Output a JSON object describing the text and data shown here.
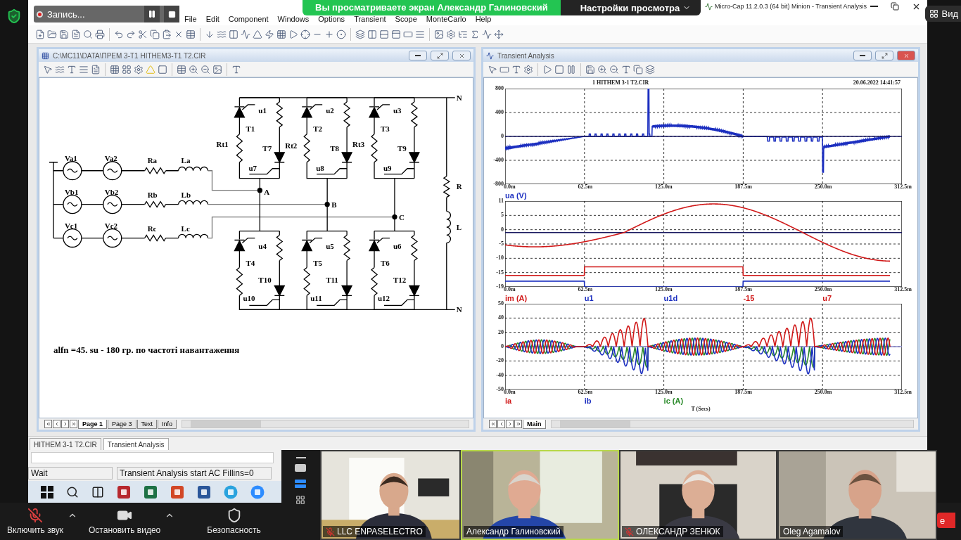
{
  "zoom": {
    "banner": "Вы просматриваете экран Александр Галиновский",
    "view_settings": "Настройки просмотра",
    "view_button": "Вид",
    "recording": "Запись...",
    "toolbar": [
      {
        "kind": "mic",
        "label": "Включить звук",
        "muted": true
      },
      {
        "kind": "video",
        "label": "Остановить видео"
      },
      {
        "kind": "security",
        "label": "Безопасность"
      }
    ],
    "layouts": [
      {
        "kind": "speaker",
        "selected": false
      },
      {
        "kind": "strip",
        "selected": true
      },
      {
        "kind": "gallery",
        "selected": false
      }
    ],
    "participants": [
      {
        "name": "LLC ENPASELECTRO",
        "muted": true,
        "speaking": false
      },
      {
        "name": "Александр Галиновский",
        "muted": false,
        "speaking": true
      },
      {
        "name": "ОЛЕКСАНДР ЗЕНЮК",
        "muted": true,
        "speaking": false
      },
      {
        "name": "Oleg Agamalov",
        "muted": false,
        "speaking": false
      }
    ],
    "leave_button": "e"
  },
  "app": {
    "title": "Micro-Cap 11.2.0.3 (64 bit) Minion - Transient Analysis",
    "menu": [
      "File",
      "Edit",
      "Component",
      "Windows",
      "Options",
      "Transient",
      "Scope",
      "MonteCarlo",
      "Help"
    ],
    "schematic": {
      "title": "C:\\MC11\\DATA\\ПРЕМ 3-Т1 HITHEM3-T1 T2.CIR",
      "labels": [
        "Va1",
        "Va2",
        "Ra",
        "La",
        "Vb1",
        "Vb2",
        "Rb",
        "Lb",
        "Vc1",
        "Vc2",
        "Rc",
        "Lc",
        "u1",
        "u2",
        "u3",
        "T1",
        "T2",
        "T3",
        "Rt1",
        "Rt2",
        "Rt3",
        "T7",
        "T8",
        "T9",
        "u7",
        "u8",
        "u9",
        "A",
        "B",
        "C",
        "u4",
        "u5",
        "u6",
        "T4",
        "T5",
        "T6",
        "T10",
        "T11",
        "T12",
        "u10",
        "u11",
        "u12",
        "N",
        "R",
        "L",
        "N"
      ],
      "caption": "alfn =45.  su - 180 гр. по частоті навантаження",
      "page_tabs": [
        {
          "label": "Page 1",
          "selected": true
        },
        {
          "label": "Page 3",
          "selected": false
        },
        {
          "label": "Text",
          "selected": false
        },
        {
          "label": "Info",
          "selected": false
        }
      ]
    },
    "transient": {
      "title": "Transient Analysis",
      "file": "1 HITHEM 3-1 T2.CIR",
      "timestamp": "20.06.2022 14:41:57",
      "plots": [
        {
          "y_ticks": [
            "800",
            "400",
            "0",
            "-400",
            "-800"
          ],
          "x_ticks": [
            "0.0m",
            "62.5m",
            "125.0m",
            "187.5m",
            "250.0m",
            "312.5m"
          ],
          "legend": [
            {
              "text": "ua (V)",
              "color": "#1c2fc0"
            }
          ]
        },
        {
          "y_ticks": [
            "11",
            "5",
            "0",
            "-5",
            "-10",
            "-15",
            "-19"
          ],
          "x_ticks": [
            "0.0m",
            "62.5m",
            "125.0m",
            "187.5m",
            "250.0m",
            "312.5m"
          ],
          "legend": [
            {
              "text": "im (A)",
              "color": "#d01818"
            },
            {
              "text": "u1",
              "color": "#1c2fc0"
            },
            {
              "text": "u1d",
              "color": "#1c2fc0"
            },
            {
              "text": "-15",
              "color": "#d01818"
            },
            {
              "text": "u7",
              "color": "#d01818"
            }
          ]
        },
        {
          "y_ticks": [
            "50",
            "40",
            "20",
            "0",
            "-20",
            "-40",
            "-50"
          ],
          "x_ticks": [
            "0.0m",
            "62.5m",
            "125.0m",
            "187.5m",
            "250.0m",
            "312.5m"
          ],
          "legend": [
            {
              "text": "ia",
              "color": "#d01818"
            },
            {
              "text": "ib",
              "color": "#1c2fc0"
            },
            {
              "text": "ic (A)",
              "color": "#2a8a2a"
            }
          ]
        }
      ],
      "x_label": "T (Secs)",
      "tabs": [
        {
          "label": "Main",
          "selected": true
        }
      ]
    },
    "doc_tabs": [
      {
        "label": "HITHEM 3-1 T2.CIR",
        "selected": false
      },
      {
        "label": "Transient Analysis",
        "selected": true
      }
    ],
    "status": [
      "Wait",
      "Transient Analysis start AC Fillins=0"
    ]
  }
}
